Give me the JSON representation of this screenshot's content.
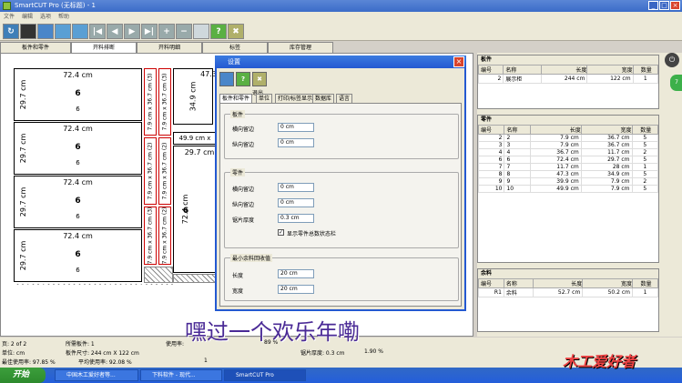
{
  "window": {
    "title": "SmartCUT Pro (无标题) - 1",
    "menu": [
      "文件",
      "编辑",
      "选项",
      "帮助"
    ]
  },
  "tabs": [
    "板件和零件",
    "开料排断",
    "开料明细",
    "标签",
    "库存管理"
  ],
  "canvas": {
    "pieces": [
      {
        "w": "72.4 cm",
        "h": "29.7 cm",
        "q": "6",
        "q2": "6"
      },
      {
        "w": "72.4 cm",
        "h": "29.7 cm",
        "q": "6",
        "q2": "6"
      },
      {
        "w": "72.4 cm",
        "h": "29.7 cm",
        "q": "6",
        "q2": "6"
      },
      {
        "w": "72.4 cm",
        "h": "29.7 cm",
        "q": "6",
        "q2": "6"
      }
    ],
    "vlabels": [
      "7.9 cm x 36.7 cm (3)",
      "7.9 cm x 36.7 cm (3)",
      "7.9 cm x 36.7 cm (2)",
      "7.9 cm x 36.7 cm (2)",
      "34.9 cm",
      "7.9 cm x 36.7 cm (3)",
      "7.9 cm x 36.7 cm (2)",
      "7.9 cm x 36.7 cm (2)"
    ],
    "p_top": "47.3",
    "p_mid": "49.9 cm x",
    "p_mid2": "29.7 cm",
    "p_big_h": "72.4 cm",
    "p_big_q": "6"
  },
  "dialog": {
    "title": "设置",
    "exit_label": "退出",
    "tabs": [
      "板件和零件",
      "单位",
      "打印/标签显示",
      "数据库",
      "语言"
    ],
    "board": {
      "legend": "板件",
      "h_margin": "横向留边",
      "h_val": "0 cm",
      "v_margin": "纵向留边",
      "v_val": "0 cm"
    },
    "part": {
      "legend": "零件",
      "h_margin": "横向留边",
      "h_val": "0 cm",
      "v_margin": "纵向留边",
      "v_val": "0 cm",
      "blade": "锯片厚度",
      "blade_val": "0.3 cm",
      "show_label": "显示零件总数状态栏"
    },
    "remnant": {
      "legend": "最小余料回收值",
      "len": "长度",
      "len_val": "20 cm",
      "wid": "宽度",
      "wid_val": "20 cm"
    }
  },
  "boards": {
    "title": "板件",
    "headers": [
      "编号",
      "名称",
      "长度",
      "宽度",
      "数量"
    ],
    "rows": [
      [
        "2",
        "展示柜",
        "244 cm",
        "122 cm",
        "1"
      ]
    ]
  },
  "parts": {
    "title": "零件",
    "headers": [
      "编号",
      "名称",
      "长度",
      "宽度",
      "数量"
    ],
    "rows": [
      [
        "2",
        "2",
        "7.9 cm",
        "36.7 cm",
        "5"
      ],
      [
        "3",
        "3",
        "7.9 cm",
        "36.7 cm",
        "5"
      ],
      [
        "4",
        "4",
        "36.7 cm",
        "11.7 cm",
        "2"
      ],
      [
        "6",
        "6",
        "72.4 cm",
        "29.7 cm",
        "5"
      ],
      [
        "7",
        "7",
        "11.7 cm",
        "28 cm",
        "1"
      ],
      [
        "8",
        "8",
        "47.3 cm",
        "34.9 cm",
        "5"
      ],
      [
        "9",
        "9",
        "39.9 cm",
        "7.9 cm",
        "2"
      ],
      [
        "10",
        "10",
        "49.9 cm",
        "7.9 cm",
        "5"
      ]
    ]
  },
  "remnants": {
    "title": "余料",
    "headers": [
      "编号",
      "名称",
      "长度",
      "宽度",
      "数量"
    ],
    "rows": [
      [
        "R1",
        "余料",
        "52.7 cm",
        "50.2 cm",
        "1"
      ]
    ]
  },
  "status": {
    "page": "页: 2 of 2",
    "board_label": "所需板件: 1",
    "used": "使用率:",
    "used_val": "89 %",
    "unit": "单位: cm",
    "board_size": "板件尺寸: 244 cm X 122 cm",
    "blade": "锯片厚度: 0.3 cm",
    "area": "1.90 %",
    "best": "最佳使用率: 97.85 %",
    "avg": "平均使用率: 92.08 %",
    "misc": "1"
  },
  "overlay_text": "嘿过一个欢乐年嘞",
  "brand": "木工爱好者",
  "taskbar": {
    "start": "开始",
    "items": [
      "中国木工爱好者等...",
      "下料软件 - 现代...",
      "SmartCUT Pro"
    ]
  }
}
